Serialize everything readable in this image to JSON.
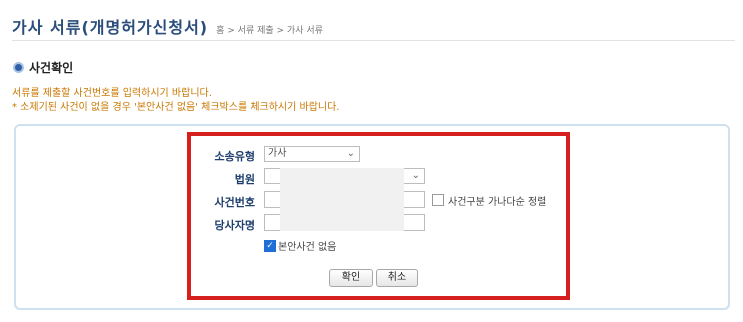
{
  "header": {
    "title": "가사 서류(개명허가신청서)",
    "breadcrumb": "홈 > 서류 제출 > 가사 서류"
  },
  "section": {
    "title": "사건확인",
    "help_line1": "서류를 제출할 사건번호를 입력하시기 바랍니다.",
    "help_line2": "* 소제기된 사건이 없을 경우 '본안사건 없음' 체크박스를 체크하시기 바랍니다."
  },
  "form": {
    "case_type_label": "소송유형",
    "case_type_value": "가사",
    "court_label": "법원",
    "court_value": "",
    "case_no_label": "사건번호",
    "party_label": "당사자명",
    "sort_option_label": "사건구분 가나다순 정렬",
    "sort_option_checked": false,
    "no_main_case_label": "본안사건 없음",
    "no_main_case_checked": true
  },
  "buttons": {
    "confirm": "확인",
    "cancel": "취소"
  },
  "colors": {
    "title": "#2a4d7a",
    "help_text": "#c97700",
    "highlight_border": "#d62020",
    "label": "#1f3f6e"
  }
}
